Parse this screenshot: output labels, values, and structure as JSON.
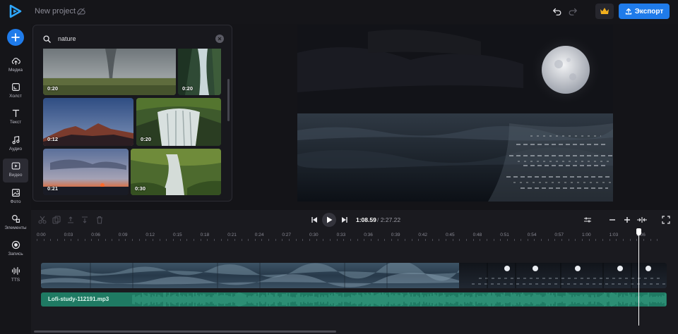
{
  "app": {
    "project_title": "New project",
    "export_label": "Экспорт"
  },
  "sidebar": {
    "items": [
      {
        "label": "Медиа",
        "icon": "cloud-upload-icon"
      },
      {
        "label": "Холст",
        "icon": "canvas-icon"
      },
      {
        "label": "Текст",
        "icon": "text-icon"
      },
      {
        "label": "Аудио",
        "icon": "music-note-icon"
      },
      {
        "label": "Видео",
        "icon": "video-icon",
        "active": true
      },
      {
        "label": "Фото",
        "icon": "image-icon"
      },
      {
        "label": "Элементы",
        "icon": "shapes-icon"
      },
      {
        "label": "Запись",
        "icon": "record-icon"
      },
      {
        "label": "TTS",
        "icon": "waveform-icon"
      }
    ]
  },
  "media_panel": {
    "search_value": "nature",
    "results": [
      {
        "duration": "0:20",
        "scene": "tornado-field"
      },
      {
        "duration": "0:20",
        "scene": "forest-stream"
      },
      {
        "duration": "0:12",
        "scene": "mountain-sunset"
      },
      {
        "duration": "0:20",
        "scene": "waterfall"
      },
      {
        "duration": "0:21",
        "scene": "dusk-sky"
      },
      {
        "duration": "0:30",
        "scene": "cascade"
      }
    ]
  },
  "timeline": {
    "current_time": "1:08.59",
    "separator": "/",
    "total_time": "2:27.22",
    "ruler_ticks": [
      "0:00",
      "0:03",
      "0:06",
      "0:09",
      "0:12",
      "0:15",
      "0:18",
      "0:21",
      "0:24",
      "0:27",
      "0:30",
      "0:33",
      "0:36",
      "0:39",
      "0:42",
      "0:45",
      "0:48",
      "0:51",
      "0:54",
      "0:57",
      "1:00",
      "1:03",
      "1:06"
    ],
    "audio_clip_name": "Lofi-study-112191.mp3",
    "playhead_fraction": 0.955
  },
  "colors": {
    "accent": "#1f7bea",
    "audio_track": "#1f7a63",
    "background": "#141418"
  }
}
